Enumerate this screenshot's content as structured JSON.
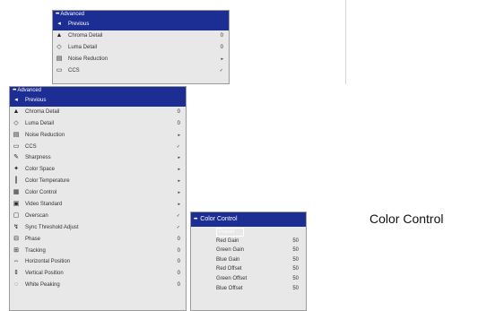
{
  "small_menu": {
    "title": "Advanced",
    "items": [
      {
        "label": "Previous",
        "icon": "back-arrow-icon",
        "selected": true,
        "indicator": ""
      },
      {
        "label": "Chroma Detail",
        "icon": "chroma-icon",
        "value": "0"
      },
      {
        "label": "Luma Detail",
        "icon": "luma-icon",
        "value": "0"
      },
      {
        "label": "Noise Reduction",
        "icon": "noise-icon",
        "value": "▸"
      },
      {
        "label": "CCS",
        "icon": "ccs-icon",
        "value": "✓"
      }
    ]
  },
  "main_menu": {
    "title": "Advanced",
    "items": [
      {
        "label": "Previous",
        "icon": "back-arrow-icon",
        "value": ""
      },
      {
        "label": "Chroma Detail",
        "icon": "chroma-icon",
        "value": "0"
      },
      {
        "label": "Luma Detail",
        "icon": "luma-icon",
        "value": "0"
      },
      {
        "label": "Noise Reduction",
        "icon": "noise-icon",
        "value": "▸"
      },
      {
        "label": "CCS",
        "icon": "ccs-icon",
        "value": "✓"
      },
      {
        "label": "Sharpness",
        "icon": "sharpness-icon",
        "value": "▸"
      },
      {
        "label": "Color Space",
        "icon": "color-space-icon",
        "value": "▸"
      },
      {
        "label": "Color Temperature",
        "icon": "thermometer-icon",
        "value": "▸"
      },
      {
        "label": "Color Control",
        "icon": "color-control-icon",
        "value": "▸"
      },
      {
        "label": "Video Standard",
        "icon": "video-standard-icon",
        "value": "▸"
      },
      {
        "label": "Overscan",
        "icon": "overscan-icon",
        "value": "✓"
      },
      {
        "label": "Sync Threshold Adjust",
        "icon": "sync-icon",
        "value": "✓"
      },
      {
        "label": "Phase",
        "icon": "phase-icon",
        "value": "0"
      },
      {
        "label": "Tracking",
        "icon": "tracking-icon",
        "value": "0"
      },
      {
        "label": "Horizontal Position",
        "icon": "horizontal-position-icon",
        "value": "0"
      },
      {
        "label": "Vertical Position",
        "icon": "vertical-position-icon",
        "value": "0"
      },
      {
        "label": "White Peaking",
        "icon": "white-peaking-icon",
        "value": "0"
      }
    ]
  },
  "color_control_menu": {
    "title": "Color Control",
    "items": [
      {
        "label": "Preset",
        "value": ""
      },
      {
        "label": "Red Gain",
        "value": "50"
      },
      {
        "label": "Green Gain",
        "value": "50"
      },
      {
        "label": "Blue Gain",
        "value": "50"
      },
      {
        "label": "Red Offset",
        "value": "50"
      },
      {
        "label": "Green Offset",
        "value": "50"
      },
      {
        "label": "Blue Offset",
        "value": "50"
      }
    ]
  },
  "caption": "Color Control",
  "colors": {
    "accent": "#1c2d93",
    "menu_bg": "#e8e8e8",
    "text": "#333333"
  }
}
